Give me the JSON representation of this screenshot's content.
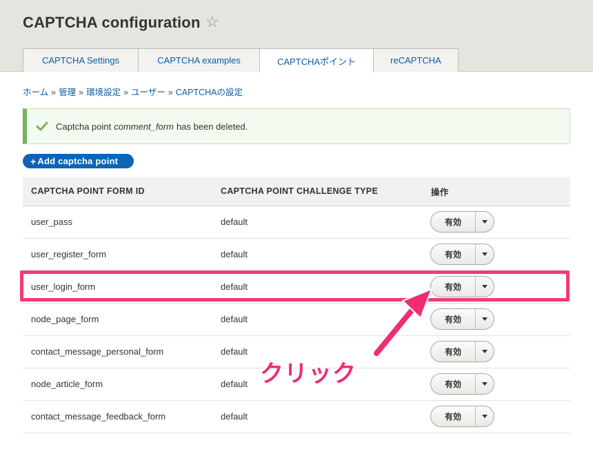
{
  "page": {
    "title": "CAPTCHA configuration",
    "star_icon": "star-outline-icon"
  },
  "tabs": [
    {
      "label": "CAPTCHA Settings",
      "active": false
    },
    {
      "label": "CAPTCHA examples",
      "active": false
    },
    {
      "label": "CAPTCHAポイント",
      "active": true
    },
    {
      "label": "reCAPTCHA",
      "active": false
    }
  ],
  "breadcrumb": {
    "items": [
      "ホーム",
      "管理",
      "環境設定",
      "ユーザー",
      "CAPTCHAの設定"
    ],
    "separator": "»"
  },
  "message": {
    "prefix": "Captcha point",
    "form_id": "comment_form",
    "suffix": "has been deleted.",
    "status_color": "#77b259"
  },
  "add_button": {
    "plus": "+",
    "label": "Add captcha point",
    "color": "#0b64b8"
  },
  "table": {
    "headers": [
      "CAPTCHA POINT FORM ID",
      "CAPTCHA POINT CHALLENGE TYPE",
      "操作"
    ],
    "rows": [
      {
        "form_id": "user_pass",
        "challenge": "default",
        "action": "有効"
      },
      {
        "form_id": "user_register_form",
        "challenge": "default",
        "action": "有効"
      },
      {
        "form_id": "user_login_form",
        "challenge": "default",
        "action": "有効"
      },
      {
        "form_id": "node_page_form",
        "challenge": "default",
        "action": "有効"
      },
      {
        "form_id": "contact_message_personal_form",
        "challenge": "default",
        "action": "有効"
      },
      {
        "form_id": "node_article_form",
        "challenge": "default",
        "action": "有効"
      },
      {
        "form_id": "contact_message_feedback_form",
        "challenge": "default",
        "action": "有効"
      }
    ]
  },
  "annotation": {
    "label": "クリック",
    "color": "#f02d74",
    "highlighted_row": "user_login_form"
  }
}
